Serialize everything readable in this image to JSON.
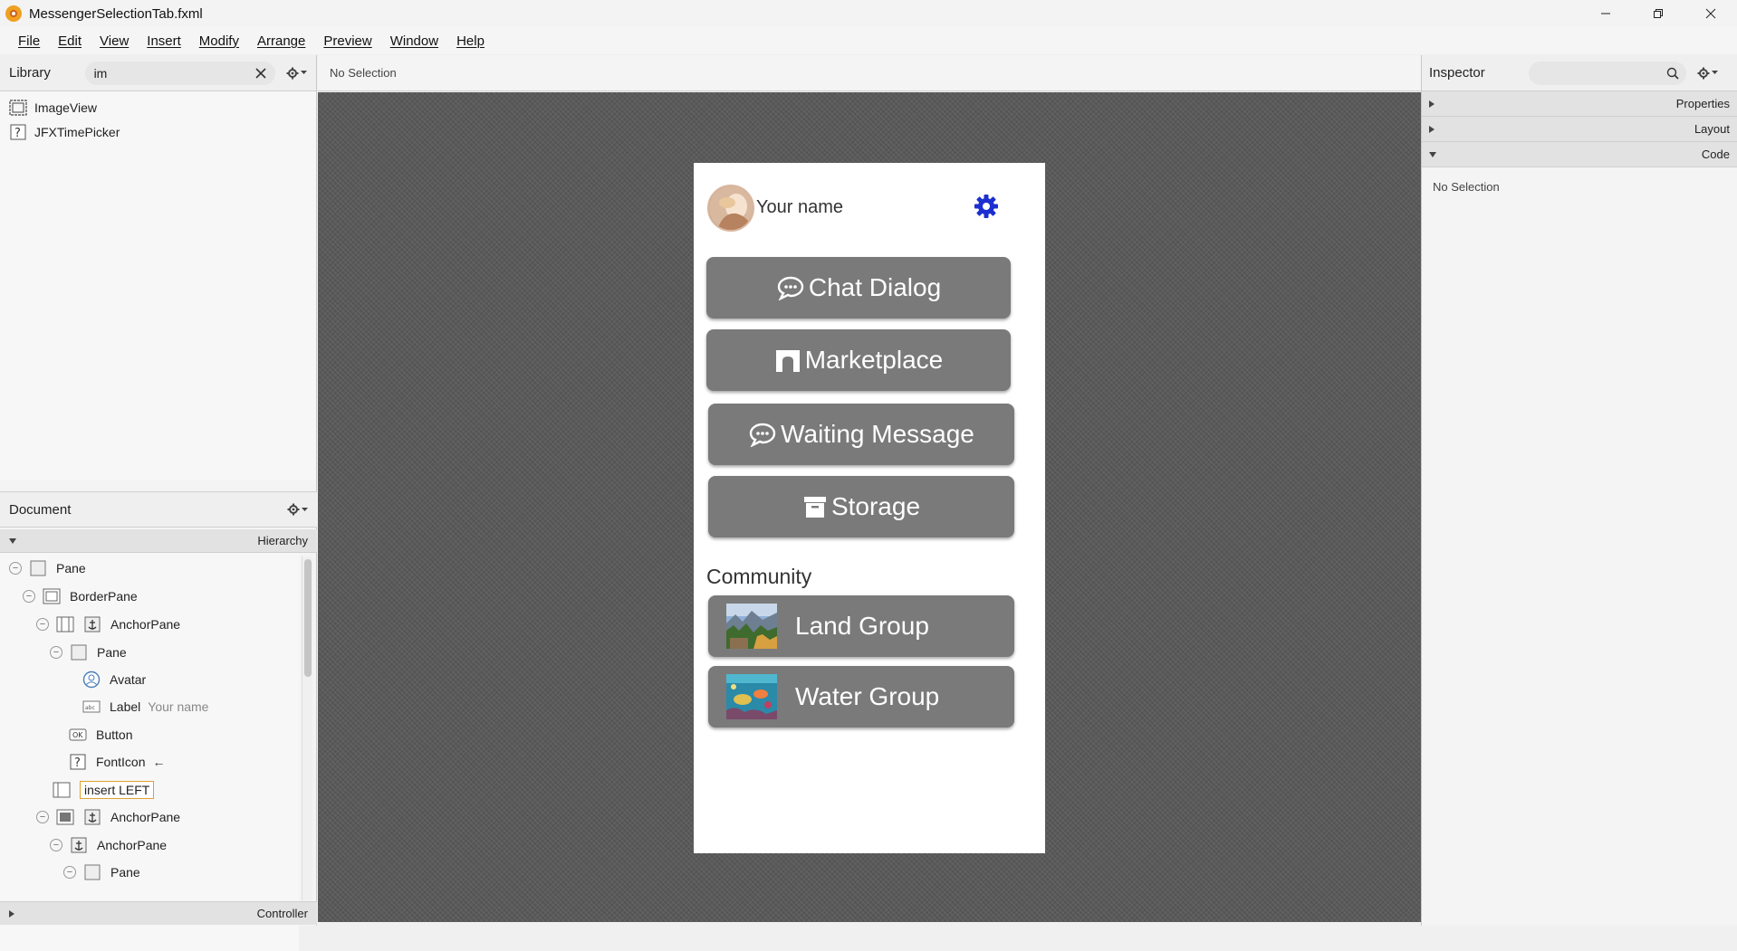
{
  "window": {
    "title": "MessengerSelectionTab.fxml"
  },
  "menu": [
    "File",
    "Edit",
    "View",
    "Insert",
    "Modify",
    "Arrange",
    "Preview",
    "Window",
    "Help"
  ],
  "library": {
    "title": "Library",
    "search_value": "im",
    "items": [
      {
        "label": "ImageView",
        "icon": "imageview-icon"
      },
      {
        "label": "JFXTimePicker",
        "icon": "unknown-icon"
      }
    ]
  },
  "document": {
    "title": "Document",
    "hierarchy_label": "Hierarchy",
    "controller_label": "Controller",
    "tree": [
      {
        "label": "Pane",
        "extra": "",
        "icon": "pane-icon"
      },
      {
        "label": "BorderPane",
        "extra": "",
        "icon": "borderpane-icon"
      },
      {
        "label": "AnchorPane",
        "extra": "",
        "icon": "anchorpane-icon"
      },
      {
        "label": "Pane",
        "extra": "",
        "icon": "pane-icon"
      },
      {
        "label": "Avatar",
        "extra": "",
        "icon": "avatar-icon"
      },
      {
        "label": "Label",
        "extra": "Your name",
        "icon": "label-icon"
      },
      {
        "label": "Button",
        "extra": "",
        "icon": "button-icon"
      },
      {
        "label": "FontIcon",
        "extra": "←",
        "icon": "unknown-icon"
      },
      {
        "label": "insert LEFT",
        "extra": "",
        "icon": "borderpane-left-icon"
      },
      {
        "label": "AnchorPane",
        "extra": "",
        "icon": "anchorpane-icon"
      },
      {
        "label": "AnchorPane",
        "extra": "",
        "icon": "anchorpane-icon"
      },
      {
        "label": "Pane",
        "extra": "",
        "icon": "pane-icon"
      }
    ]
  },
  "center": {
    "selection_text": "No Selection"
  },
  "phone": {
    "user_name": "Your name",
    "buttons": [
      {
        "label": "Chat Dialog",
        "icon": "chat-bubble-icon"
      },
      {
        "label": "Marketplace",
        "icon": "store-icon"
      },
      {
        "label": "Waiting Message",
        "icon": "chat-bubble-icon"
      },
      {
        "label": "Storage",
        "icon": "archive-icon"
      }
    ],
    "community_label": "Community",
    "groups": [
      {
        "label": "Land Group",
        "icon": "land-thumbnail"
      },
      {
        "label": "Water Group",
        "icon": "water-thumbnail"
      }
    ],
    "accent_color": "#1c2fd0",
    "button_color": "#7a7a7a"
  },
  "inspector": {
    "title": "Inspector",
    "sections": [
      "Properties",
      "Layout",
      "Code"
    ],
    "body_text": "No Selection"
  }
}
